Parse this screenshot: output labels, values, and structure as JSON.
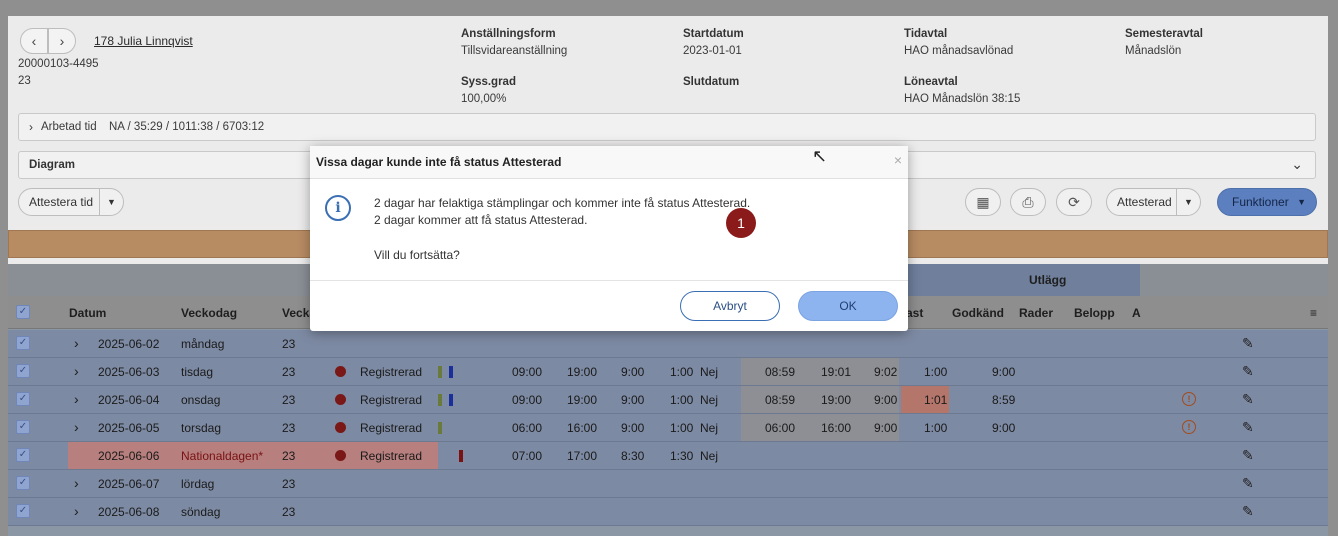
{
  "header": {
    "employee_link": "178 Julia Linnqvist",
    "personal_number": "20000103-4495",
    "number": "23",
    "fields": [
      {
        "label": "Anställningsform",
        "value": "Tillsvidareanställning"
      },
      {
        "label": "Startdatum",
        "value": "2023-01-01"
      },
      {
        "label": "Tidavtal",
        "value": "HAO månadsavlönad"
      },
      {
        "label": "Semesteravtal",
        "value": "Månadslön"
      },
      {
        "label": "Syss.grad",
        "value": "100,00%"
      },
      {
        "label": "Slutdatum",
        "value": ""
      },
      {
        "label": "Löneavtal",
        "value": "HAO Månadslön 38:15"
      }
    ]
  },
  "worked_time": {
    "label": "Arbetad tid",
    "value": "NA / 35:29 / 1011:38 / 6703:12"
  },
  "diagram_label": "Diagram",
  "toolbar": {
    "attest_label": "Attestera tid",
    "status_select": "Attesterad",
    "functions_label": "Funktioner"
  },
  "table": {
    "group_header": "Utlägg",
    "columns": [
      "Datum",
      "Veckodag",
      "Vecka",
      "ast",
      "Godkänd",
      "Rader",
      "Belopp",
      "A"
    ],
    "rows": [
      {
        "date": "2025-06-02",
        "day": "måndag",
        "week": "23",
        "status": "",
        "start": "",
        "end": "",
        "total": "",
        "break": "",
        "nej": "",
        "s1": "",
        "s2": "",
        "s3": "",
        "ast": "",
        "approved": "",
        "warn": false,
        "dot": false
      },
      {
        "date": "2025-06-03",
        "day": "tisdag",
        "week": "23",
        "status": "Registrerad",
        "start": "09:00",
        "end": "19:00",
        "total": "9:00",
        "break": "1:00",
        "nej": "Nej",
        "s1": "08:59",
        "s2": "19:01",
        "s3": "9:02",
        "ast": "1:00",
        "approved": "9:00",
        "warn": false,
        "dot": true
      },
      {
        "date": "2025-06-04",
        "day": "onsdag",
        "week": "23",
        "status": "Registrerad",
        "start": "09:00",
        "end": "19:00",
        "total": "9:00",
        "break": "1:00",
        "nej": "Nej",
        "s1": "08:59",
        "s2": "19:00",
        "s3": "9:00",
        "ast": "1:01",
        "approved": "8:59",
        "warn": true,
        "dot": true
      },
      {
        "date": "2025-06-05",
        "day": "torsdag",
        "week": "23",
        "status": "Registrerad",
        "start": "06:00",
        "end": "16:00",
        "total": "9:00",
        "break": "1:00",
        "nej": "Nej",
        "s1": "06:00",
        "s2": "16:00",
        "s3": "9:00",
        "ast": "1:00",
        "approved": "9:00",
        "warn": true,
        "dot": true
      },
      {
        "date": "2025-06-06",
        "day": "Nationaldagen*",
        "week": "23",
        "status": "Registrerad",
        "start": "07:00",
        "end": "17:00",
        "total": "8:30",
        "break": "1:30",
        "nej": "Nej",
        "s1": "",
        "s2": "",
        "s3": "",
        "ast": "",
        "approved": "",
        "warn": false,
        "dot": true
      },
      {
        "date": "2025-06-07",
        "day": "lördag",
        "week": "23",
        "status": "",
        "start": "",
        "end": "",
        "total": "",
        "break": "",
        "nej": "",
        "s1": "",
        "s2": "",
        "s3": "",
        "ast": "",
        "approved": "",
        "warn": false,
        "dot": false
      },
      {
        "date": "2025-06-08",
        "day": "söndag",
        "week": "23",
        "status": "",
        "start": "",
        "end": "",
        "total": "",
        "break": "",
        "nej": "",
        "s1": "",
        "s2": "",
        "s3": "",
        "ast": "",
        "approved": "",
        "warn": false,
        "dot": false
      }
    ]
  },
  "dialog": {
    "title": "Vissa dagar kunde inte få status Attesterad",
    "line1": "2 dagar har felaktiga stämplingar och kommer inte få status Attesterad.",
    "line2": "2 dagar kommer att få status Attesterad.",
    "question": "Vill du fortsätta?",
    "cancel": "Avbryt",
    "ok": "OK",
    "close": "×"
  },
  "badge": "1",
  "icons": [
    "chevron-left-icon",
    "chevron-right-icon",
    "calendar-icon",
    "print-icon",
    "refresh-icon",
    "info-icon",
    "edit-icon",
    "warning-icon"
  ]
}
